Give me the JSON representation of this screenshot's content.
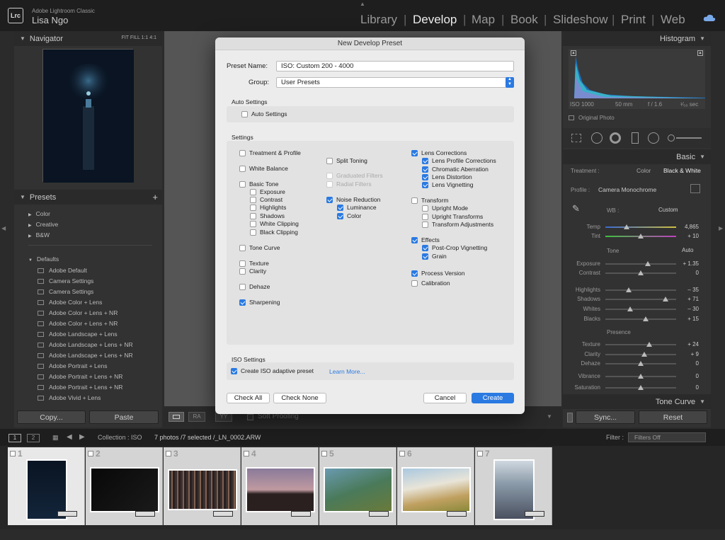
{
  "app": {
    "logo": "Lrc",
    "name": "Adobe Lightroom Classic",
    "user": "Lisa Ngo"
  },
  "modules": [
    "Library",
    "Develop",
    "Map",
    "Book",
    "Slideshow",
    "Print",
    "Web"
  ],
  "navigator": {
    "title": "Navigator",
    "zoom": "FIT  FILL  1:1  4:1"
  },
  "presets": {
    "title": "Presets",
    "add": "+",
    "groups": [
      "Color",
      "Creative",
      "B&W"
    ],
    "defaults_title": "Defaults",
    "items": [
      "Adobe Default",
      "Camera Settings",
      "Camera Settings",
      "Adobe Color + Lens",
      "Adobe Color + Lens + NR",
      "Adobe Color + Lens + NR",
      "Adobe Landscape + Lens",
      "Adobe Landscape + Lens + NR",
      "Adobe Landscape + Lens + NR",
      "Adobe Portrait + Lens",
      "Adobe Portrait + Lens + NR",
      "Adobe Portrait + Lens + NR",
      "Adobe Vivid + Lens"
    ]
  },
  "left_buttons": {
    "copy": "Copy...",
    "paste": "Paste"
  },
  "toolbar": {
    "soft_proofing": "Soft Proofing"
  },
  "histogram": {
    "title": "Histogram",
    "iso": "ISO 1000",
    "focal": "50 mm",
    "aperture": "f / 1.6",
    "shutter": "¹⁄₅₀ sec",
    "original": "Original Photo"
  },
  "basic": {
    "title": "Basic",
    "treatment_label": "Treatment :",
    "treatment_color": "Color",
    "treatment_bw": "Black & White",
    "profile_label": "Profile :",
    "profile_value": "Camera Monochrome",
    "wb_label": "WB :",
    "wb_value": "Custom",
    "temp": {
      "label": "Temp",
      "value": "4,865",
      "pos": 0.3
    },
    "tint": {
      "label": "Tint",
      "value": "+ 10",
      "pos": 0.5
    },
    "tone_label": "Tone",
    "auto": "Auto",
    "sliders": [
      {
        "label": "Exposure",
        "value": "+ 1.35",
        "pos": 0.6
      },
      {
        "label": "Contrast",
        "value": "0",
        "pos": 0.5
      },
      {
        "label": "Highlights",
        "value": "– 35",
        "pos": 0.33
      },
      {
        "label": "Shadows",
        "value": "+ 71",
        "pos": 0.85
      },
      {
        "label": "Whites",
        "value": "– 30",
        "pos": 0.35
      },
      {
        "label": "Blacks",
        "value": "+ 15",
        "pos": 0.57
      }
    ],
    "presence_label": "Presence",
    "presence": [
      {
        "label": "Texture",
        "value": "+ 24",
        "pos": 0.62
      },
      {
        "label": "Clarity",
        "value": "+ 9",
        "pos": 0.55
      },
      {
        "label": "Dehaze",
        "value": "0",
        "pos": 0.5
      },
      {
        "label": "Vibrance",
        "value": "0",
        "pos": 0.5
      },
      {
        "label": "Saturation",
        "value": "0",
        "pos": 0.5
      }
    ]
  },
  "tone_curve": {
    "title": "Tone Curve"
  },
  "right_buttons": {
    "sync": "Sync...",
    "reset": "Reset"
  },
  "filmbar": {
    "collection": "Collection : ISO",
    "count": "7 photos /7 selected /_LN_0002.ARW",
    "filter_label": "Filter :",
    "filter_value": "Filters Off",
    "pages": [
      "1",
      "2"
    ]
  },
  "film_numbers": [
    "1",
    "2",
    "3",
    "4",
    "5",
    "6",
    "7"
  ],
  "dialog": {
    "title": "New Develop Preset",
    "preset_name_label": "Preset Name:",
    "preset_name": "ISO: Custom 200 - 4000",
    "group_label": "Group:",
    "group": "User Presets",
    "auto_section": "Auto Settings",
    "auto_check": "Auto Settings",
    "settings_section": "Settings",
    "col1": [
      {
        "label": "Treatment & Profile",
        "on": false
      },
      {
        "label": "White Balance",
        "on": false
      },
      {
        "label": "Basic Tone",
        "on": false
      },
      {
        "label": "Exposure",
        "on": false,
        "sub": true
      },
      {
        "label": "Contrast",
        "on": false,
        "sub": true
      },
      {
        "label": "Highlights",
        "on": false,
        "sub": true
      },
      {
        "label": "Shadows",
        "on": false,
        "sub": true
      },
      {
        "label": "White Clipping",
        "on": false,
        "sub": true
      },
      {
        "label": "Black Clipping",
        "on": false,
        "sub": true
      },
      {
        "label": "Tone Curve",
        "on": false
      },
      {
        "label": "Texture",
        "on": false
      },
      {
        "label": "Clarity",
        "on": false
      },
      {
        "label": "Dehaze",
        "on": false
      },
      {
        "label": "Sharpening",
        "on": true
      }
    ],
    "col2": [
      {
        "label": "Split Toning",
        "on": false
      },
      {
        "label": "Graduated Filters",
        "on": false,
        "dis": true
      },
      {
        "label": "Radial Filters",
        "on": false,
        "dis": true
      },
      {
        "label": "Noise Reduction",
        "on": true
      },
      {
        "label": "Luminance",
        "on": true,
        "sub": true
      },
      {
        "label": "Color",
        "on": true,
        "sub": true
      }
    ],
    "col3": [
      {
        "label": "Lens Corrections",
        "on": true
      },
      {
        "label": "Lens Profile Corrections",
        "on": true,
        "sub": true
      },
      {
        "label": "Chromatic Aberration",
        "on": true,
        "sub": true
      },
      {
        "label": "Lens Distortion",
        "on": true,
        "sub": true
      },
      {
        "label": "Lens Vignetting",
        "on": true,
        "sub": true
      },
      {
        "label": "Transform",
        "on": false
      },
      {
        "label": "Upright Mode",
        "on": false,
        "sub": true
      },
      {
        "label": "Upright Transforms",
        "on": false,
        "sub": true
      },
      {
        "label": "Transform Adjustments",
        "on": false,
        "sub": true
      },
      {
        "label": "Effects",
        "on": true
      },
      {
        "label": "Post-Crop Vignetting",
        "on": true,
        "sub": true
      },
      {
        "label": "Grain",
        "on": true,
        "sub": true
      },
      {
        "label": "Process Version",
        "on": true
      },
      {
        "label": "Calibration",
        "on": false
      }
    ],
    "iso_section": "ISO Settings",
    "iso_check": "Create ISO adaptive preset",
    "learn_more": "Learn More...",
    "check_all": "Check All",
    "check_none": "Check None",
    "cancel": "Cancel",
    "create": "Create"
  },
  "colors": {
    "accent": "#2a7ae2",
    "link": "#2a7ae2"
  }
}
